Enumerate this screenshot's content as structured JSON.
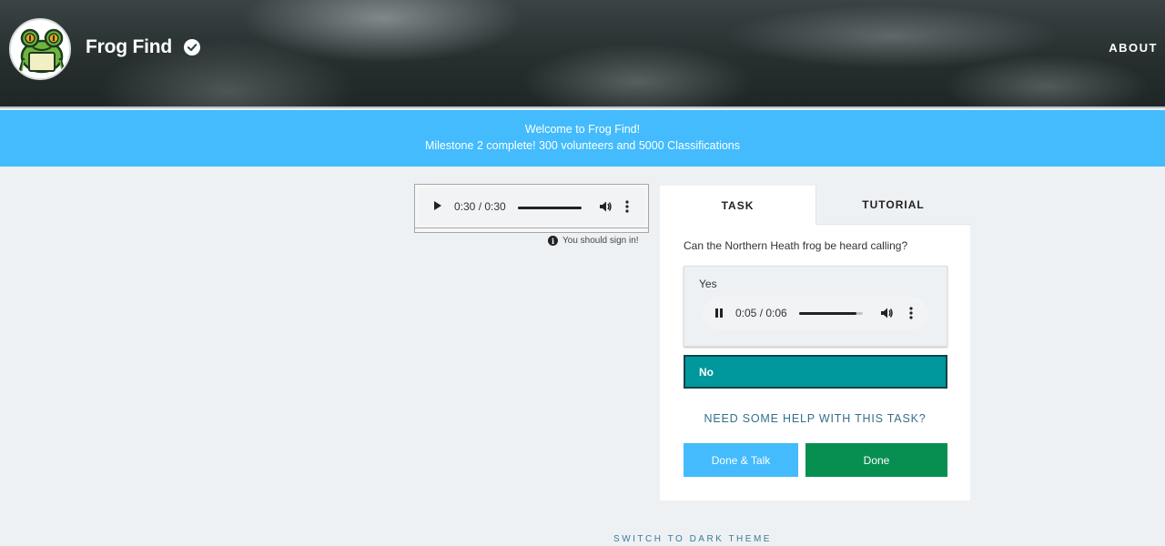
{
  "header": {
    "project_title": "Frog Find",
    "about_label": "ABOUT"
  },
  "icons": {
    "avatar": "frog-avatar",
    "verified": "check-badge-icon"
  },
  "announcement": {
    "line1": "Welcome to Frog Find!",
    "line2": "Milestone 2 complete! 300 volunteers and 5000 Classifications"
  },
  "subject": {
    "audio_time": "0:30 / 0:30",
    "audio_progress": 1.0,
    "signin_notice": "You should sign in!"
  },
  "task_panel": {
    "tabs": [
      "TASK",
      "TUTORIAL"
    ],
    "active_tab": "TASK",
    "question": "Can the Northern Heath frog be heard calling?",
    "answers": [
      {
        "label": "Yes",
        "audio_time": "0:05 / 0:06",
        "audio_progress": 0.9,
        "selected": false
      },
      {
        "label": "No",
        "selected": true
      }
    ],
    "help_link": "NEED SOME HELP WITH THIS TASK?",
    "done_talk_label": "Done & Talk",
    "done_label": "Done"
  },
  "footer": {
    "theme_toggle": "SWITCH TO DARK THEME"
  },
  "colors": {
    "banner": "#43bbfd",
    "selected_answer": "#00979d",
    "done_button": "#078f52",
    "done_talk_button": "#43bbfd",
    "link": "#33708a"
  }
}
